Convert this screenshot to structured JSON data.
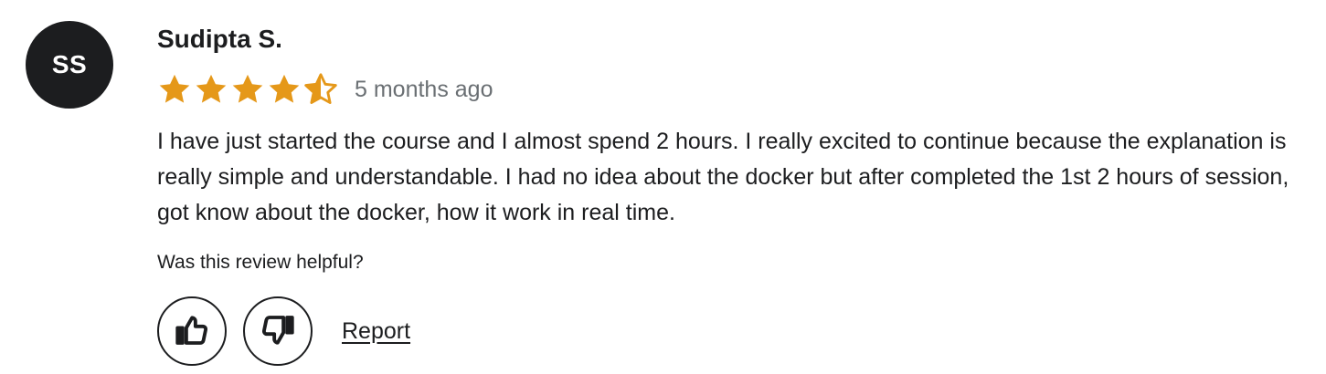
{
  "review": {
    "avatar_initials": "SS",
    "reviewer_name": "Sudipta S.",
    "rating": 4.5,
    "rating_max": 5,
    "star_color": "#e59819",
    "time_ago": "5 months ago",
    "text": "I have just started the course and I almost spend 2 hours. I really excited to continue because the explanation is really simple and understandable. I had no idea about the docker but after completed the 1st 2 hours of session, got know about the docker, how it work in real time.",
    "helpful_prompt": "Was this review helpful?",
    "actions": {
      "thumbs_up_icon": "thumbs-up-icon",
      "thumbs_down_icon": "thumbs-down-icon",
      "report_label": "Report"
    }
  }
}
